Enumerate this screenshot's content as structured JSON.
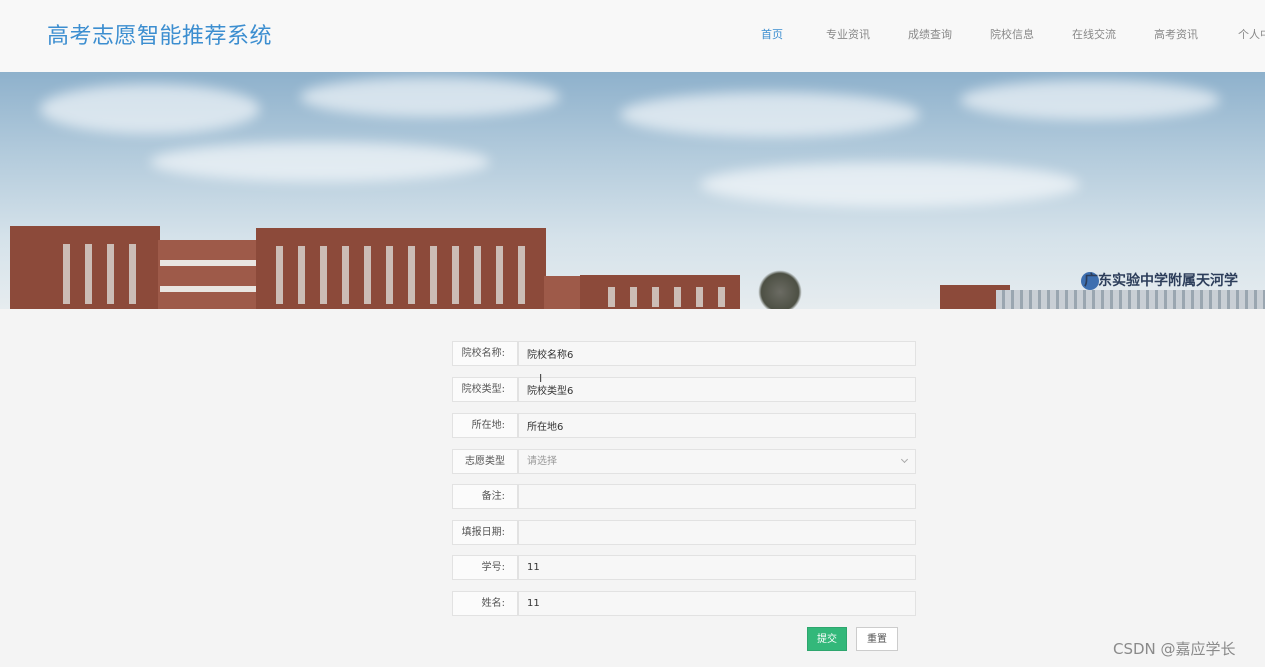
{
  "header": {
    "title": "高考志愿智能推荐系统",
    "nav": [
      {
        "label": "首页"
      },
      {
        "label": "专业资讯"
      },
      {
        "label": "成绩查询"
      },
      {
        "label": "院校信息"
      },
      {
        "label": "在线交流"
      },
      {
        "label": "高考资讯"
      },
      {
        "label": "个人中"
      }
    ]
  },
  "banner": {
    "sign_text": "广东实验中学附属天河学"
  },
  "form": {
    "fields": [
      {
        "label": "院校名称:",
        "value": "院校名称6"
      },
      {
        "label": "院校类型:",
        "value": "院校类型6"
      },
      {
        "label": "所在地:",
        "value": "所在地6"
      },
      {
        "label": "志愿类型",
        "placeholder": "请选择"
      },
      {
        "label": "备注:",
        "value": ""
      },
      {
        "label": "填报日期:",
        "value": ""
      },
      {
        "label": "学号:",
        "value": "11"
      },
      {
        "label": "姓名:",
        "value": "11"
      }
    ],
    "submit_label": "提交",
    "reset_label": "重置"
  },
  "watermark": "CSDN @嘉应学长",
  "colors": {
    "brand": "#3c8ed0",
    "submit": "#33b87a"
  }
}
